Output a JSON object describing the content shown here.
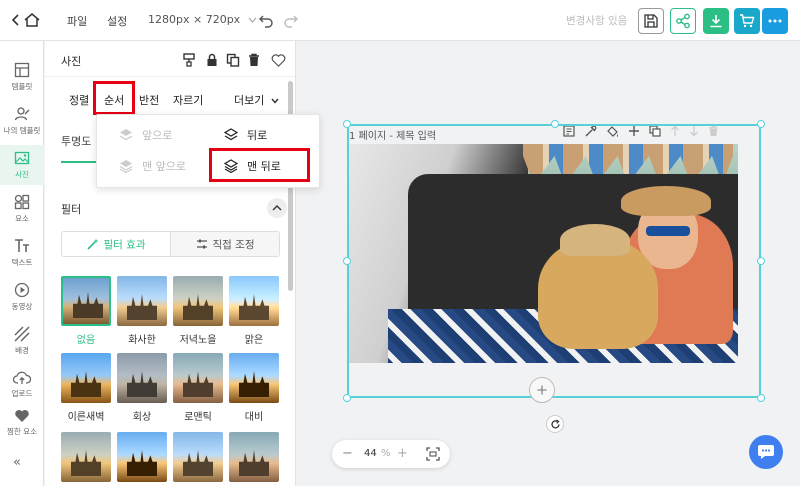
{
  "topbar": {
    "menu": [
      "파일",
      "설정"
    ],
    "canvas_size": "1280px × 720px",
    "status": "변경사항 있음"
  },
  "rail": {
    "items": [
      {
        "label": "템플릿",
        "icon": "template-icon"
      },
      {
        "label": "나의 템플릿",
        "icon": "my-template-icon"
      },
      {
        "label": "사진",
        "icon": "photo-icon",
        "active": true
      },
      {
        "label": "요소",
        "icon": "elements-icon"
      },
      {
        "label": "텍스트",
        "icon": "text-icon"
      },
      {
        "label": "동영상",
        "icon": "video-icon"
      },
      {
        "label": "배경",
        "icon": "background-icon"
      },
      {
        "label": "업로드",
        "icon": "upload-icon"
      },
      {
        "label": "찜한 요소",
        "icon": "heart-icon"
      }
    ],
    "collapse": "«"
  },
  "panel": {
    "title": "사진",
    "tabs": {
      "align": "정렬",
      "order": "순서",
      "flip": "반전",
      "crop": "자르기",
      "more": "더보기"
    },
    "opacity": "투명도",
    "filter_title": "필터",
    "filter_effect": "필터 효과",
    "manual_adjust": "직접 조정",
    "thumbnails": [
      "없음",
      "화사한",
      "저녁노을",
      "맑은",
      "이른새벽",
      "회상",
      "로맨틱",
      "대비"
    ]
  },
  "dropdown": {
    "forward": "앞으로",
    "to_front": "맨 앞으로",
    "backward": "뒤로",
    "to_back": "맨 뒤로"
  },
  "canvas": {
    "page_label": "1 페이지 - 제목 입력"
  },
  "zoom": {
    "value": "44",
    "unit": "%",
    "minus": "−",
    "plus": "+"
  },
  "colors": {
    "accent": "#2bbf86",
    "highlight": "#e60012",
    "selection": "#57d0dc"
  }
}
